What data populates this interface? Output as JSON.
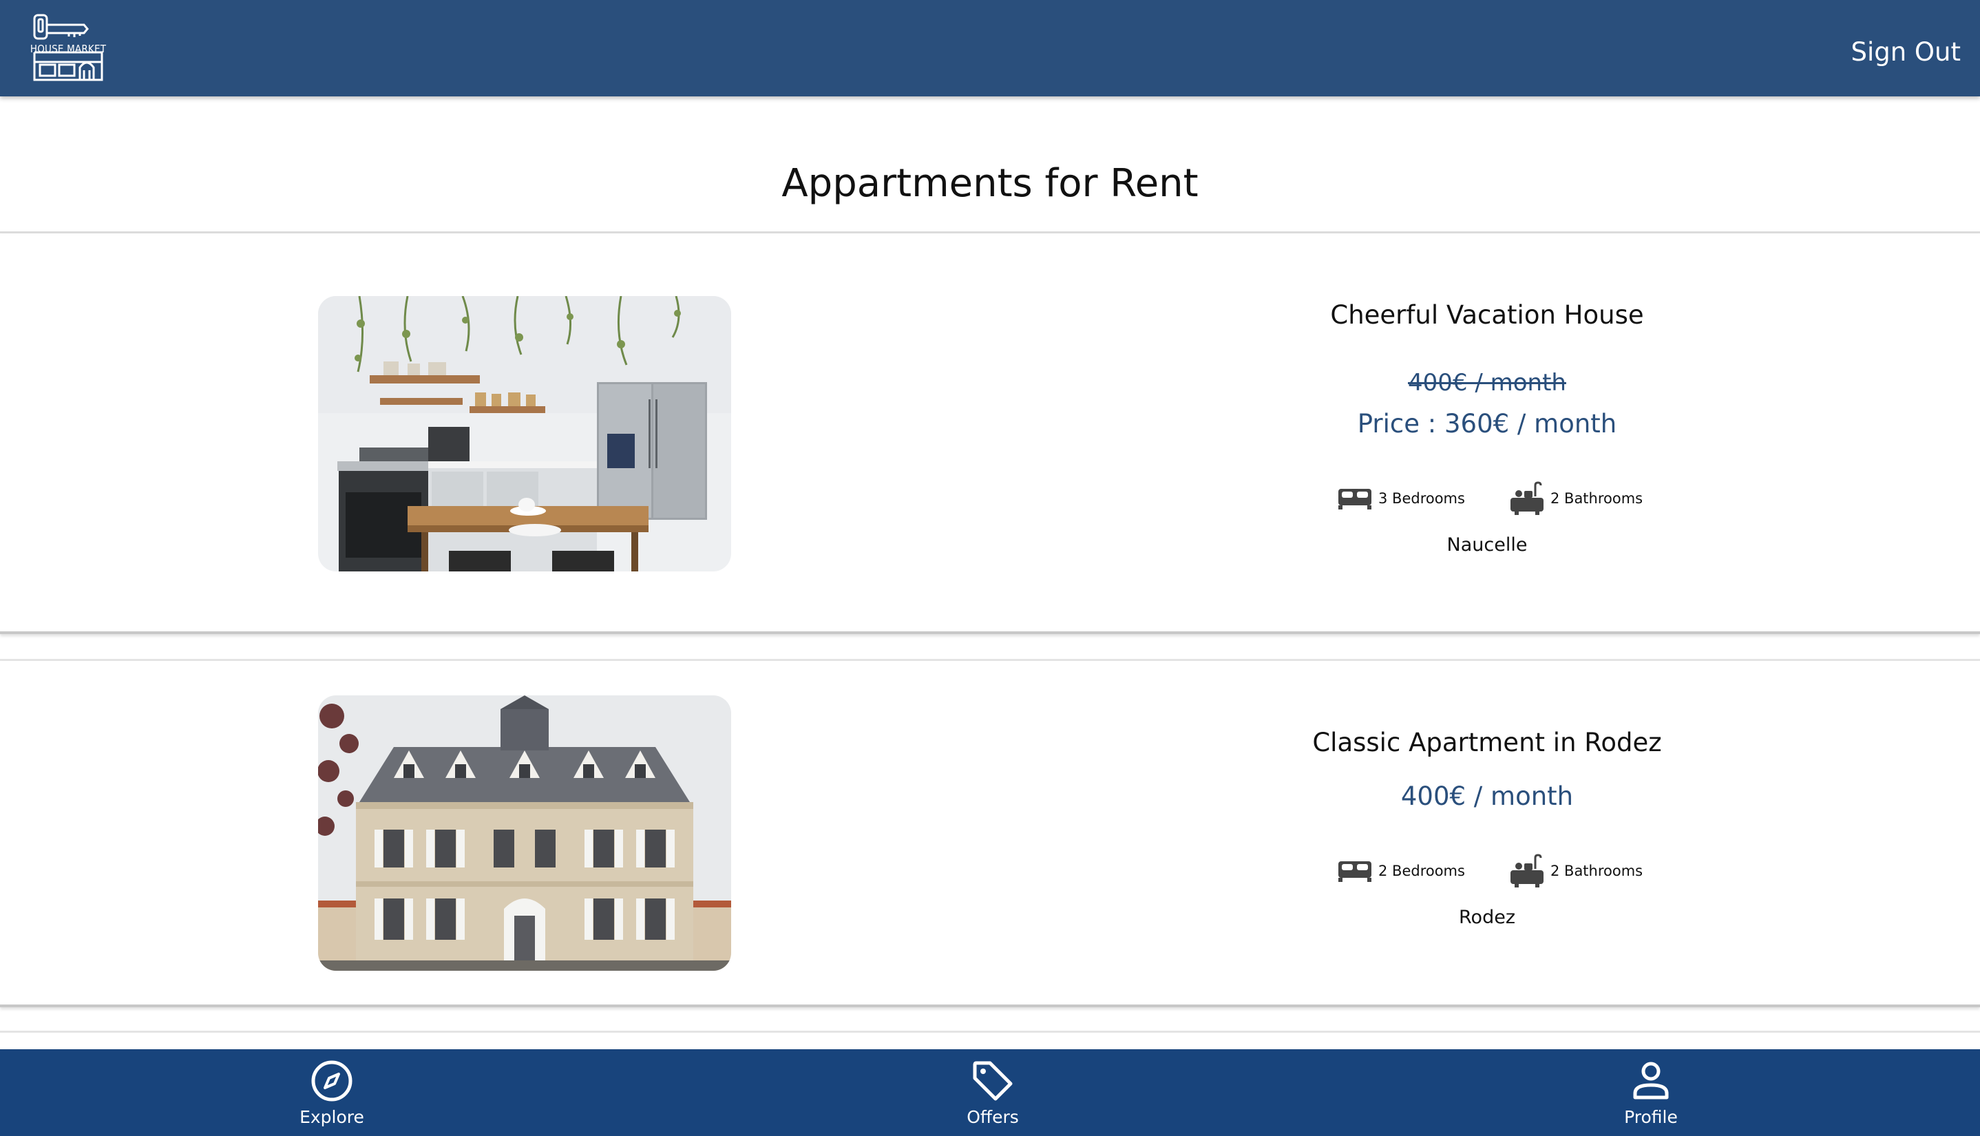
{
  "header": {
    "logo_text": "HOUSE MARKET",
    "signout_label": "Sign Out"
  },
  "page": {
    "title": "Appartments for Rent"
  },
  "listings": [
    {
      "name": "Cheerful Vacation House",
      "old_price": "400€ / month",
      "price": "Price : 360€ / month",
      "bedrooms": "3 Bedrooms",
      "bathrooms": "2 Bathrooms",
      "city": "Naucelle",
      "image": "kitchen-photo"
    },
    {
      "name": "Classic Apartment in Rodez",
      "price": "400€ / month",
      "bedrooms": "2 Bedrooms",
      "bathrooms": "2 Bathrooms",
      "city": "Rodez",
      "image": "stone-manor-photo"
    }
  ],
  "nav": {
    "explore_label": "Explore",
    "offers_label": "Offers",
    "profile_label": "Profile"
  },
  "colors": {
    "header": "#2a4f7c",
    "bottom_nav": "#18447c",
    "price_accent": "#2a4f7c"
  }
}
